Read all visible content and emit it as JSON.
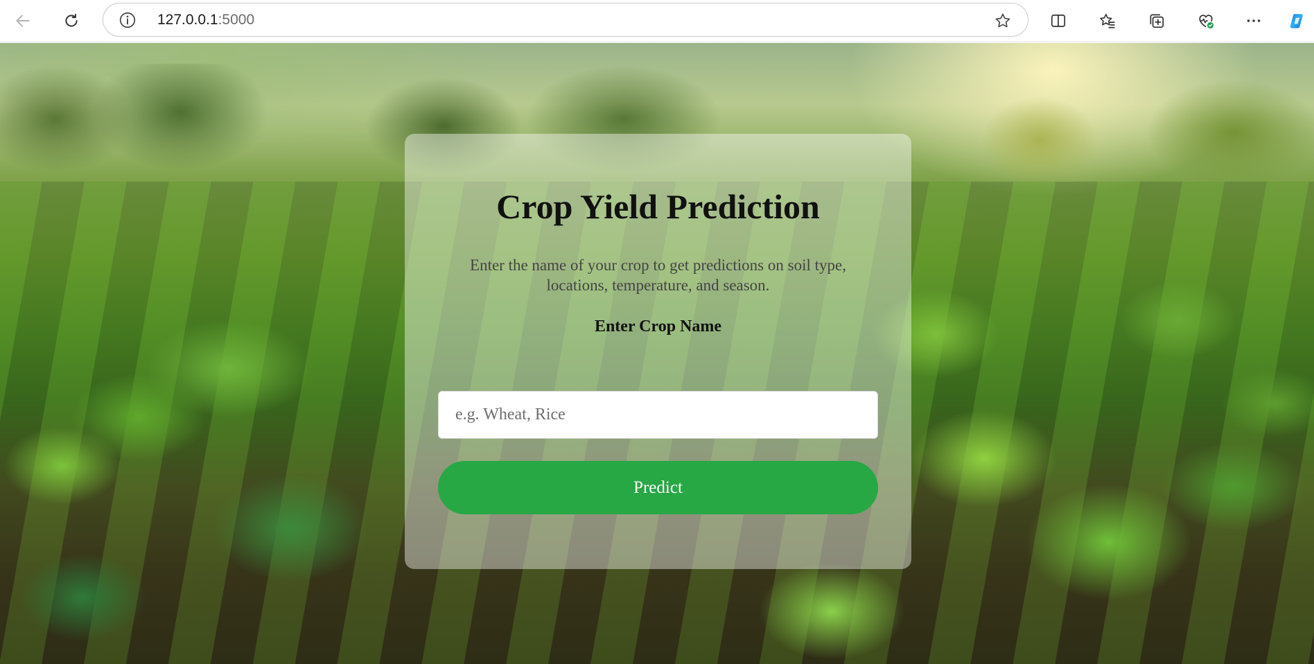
{
  "browser": {
    "url_host": "127.0.0.1",
    "url_port": ":5000",
    "icons": [
      "back-icon",
      "refresh-icon",
      "site-info-icon",
      "favorite-star-icon",
      "split-screen-icon",
      "favorites-icon",
      "collections-icon",
      "browser-essentials-icon",
      "more-icon",
      "copilot-icon"
    ]
  },
  "page": {
    "title": "Crop Yield Prediction",
    "subtitle": "Enter the name of your crop to get predictions on soil type, locations, temperature, and season.",
    "field_label": "Enter Crop Name",
    "input_placeholder": "e.g. Wheat, Rice",
    "input_value": "",
    "button_label": "Predict"
  },
  "colors": {
    "button": "#28a745",
    "card_overlay": "rgba(255,255,255,0.42)"
  }
}
